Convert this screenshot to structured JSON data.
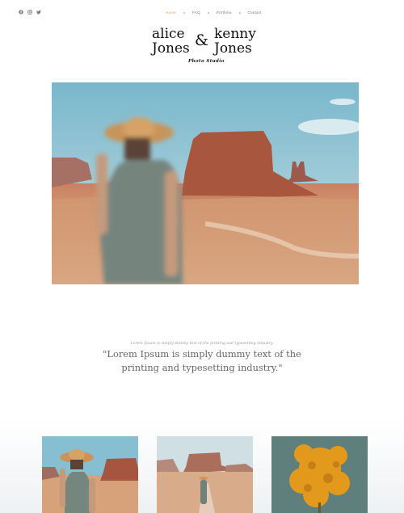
{
  "header": {
    "social": [
      {
        "icon": "facebook-icon"
      },
      {
        "icon": "instagram-icon"
      },
      {
        "icon": "twitter-icon"
      }
    ],
    "nav": [
      {
        "label": "Home",
        "active": true
      },
      {
        "label": "FAQ",
        "active": false
      },
      {
        "label": "Portfolio",
        "active": false
      },
      {
        "label": "Contact",
        "active": false
      }
    ]
  },
  "logo": {
    "left_line1": "alice",
    "left_line2": "Jones",
    "ampersand": "&",
    "right_line1": "kenny",
    "right_line2": "Jones",
    "subtitle": "Photo Studio"
  },
  "quote": {
    "small": "Lorem Ipsum is simply dummy text of the printing and typesetting industry.",
    "large": "\"Lorem Ipsum is simply dummy text of the printing and typesetting industry.\""
  },
  "colors": {
    "accent": "#d9a679",
    "sky": "#8fc3d4",
    "sand": "#d9a37a",
    "rock": "#a9563f"
  }
}
